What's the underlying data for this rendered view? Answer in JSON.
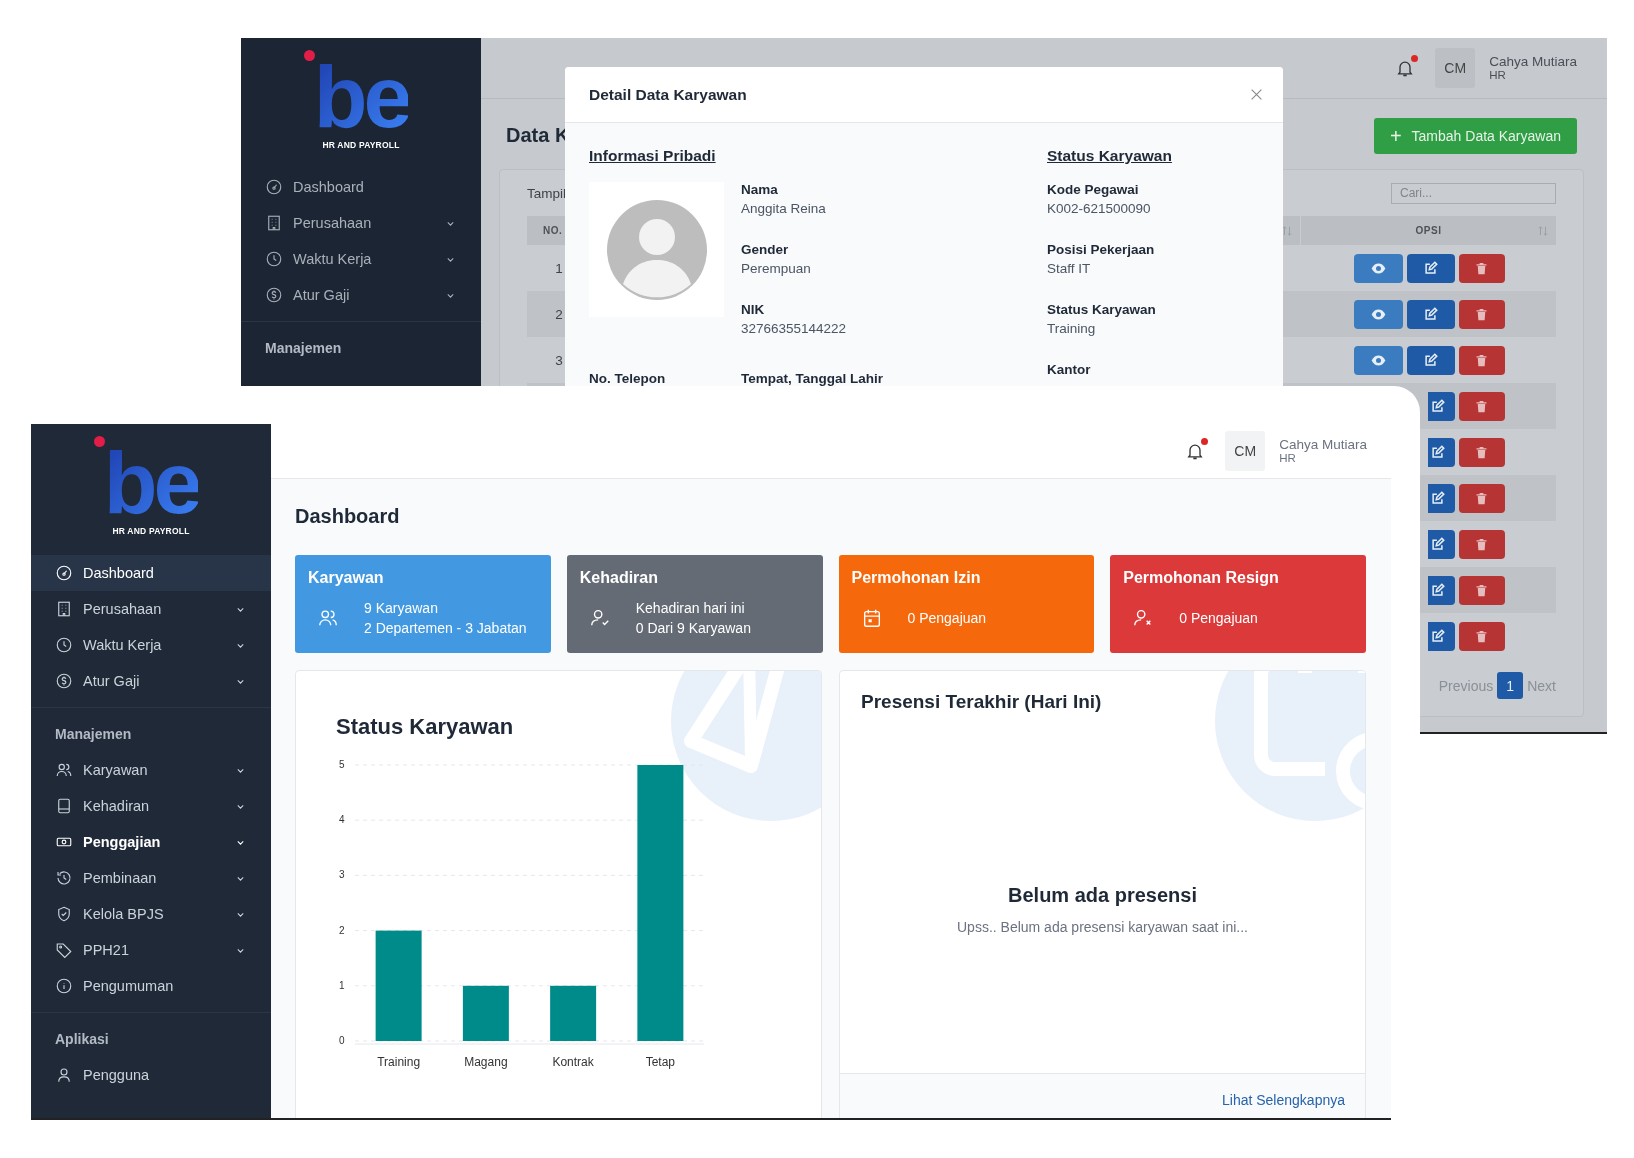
{
  "back_window": {
    "sidebar": {
      "logo": {
        "mark": "be",
        "caption": "HR AND PAYROLL"
      },
      "items": [
        {
          "label": "Dashboard",
          "has_submenu": false
        },
        {
          "label": "Perusahaan",
          "has_submenu": true
        },
        {
          "label": "Waktu Kerja",
          "has_submenu": true
        },
        {
          "label": "Atur Gaji",
          "has_submenu": true
        }
      ],
      "section_title": "Manajemen"
    },
    "header": {
      "has_notification": true,
      "user": {
        "initials": "CM",
        "name": "Cahya Mutiara",
        "role": "HR"
      }
    },
    "page_title": "Data K",
    "add_button": {
      "icon": "+",
      "label": "Tambah Data Karyawan"
    },
    "table_card": {
      "show_label": "Tampil",
      "search": {
        "placeholder": "Cari..."
      },
      "columns": [
        "NO.",
        "OPSI"
      ],
      "rows": [
        {
          "number": "1",
          "actions": [
            {
              "kind": "view"
            },
            {
              "kind": "edit"
            },
            {
              "kind": "delete"
            }
          ]
        },
        {
          "number": "2",
          "actions": [
            {
              "kind": "view"
            },
            {
              "kind": "edit"
            },
            {
              "kind": "delete"
            }
          ]
        },
        {
          "number": "3",
          "actions": [
            {
              "kind": "view"
            },
            {
              "kind": "edit"
            },
            {
              "kind": "delete"
            }
          ]
        },
        {
          "actions": [
            {
              "kind": "edit"
            },
            {
              "kind": "delete"
            }
          ]
        },
        {
          "actions": [
            {
              "kind": "edit"
            },
            {
              "kind": "delete"
            }
          ]
        },
        {
          "actions": [
            {
              "kind": "edit"
            },
            {
              "kind": "delete"
            }
          ]
        },
        {
          "actions": [
            {
              "kind": "edit"
            },
            {
              "kind": "delete"
            }
          ]
        },
        {
          "actions": [
            {
              "kind": "edit"
            },
            {
              "kind": "delete"
            }
          ]
        },
        {
          "actions": [
            {
              "kind": "edit"
            },
            {
              "kind": "delete"
            }
          ]
        }
      ],
      "pagination": {
        "previous": "Previous",
        "pages": [
          {
            "label": "1",
            "selected": true
          }
        ],
        "next": "Next"
      }
    },
    "modal": {
      "title": "Detail Data Karyawan",
      "personal": {
        "heading": "Informasi Pribadi",
        "fields": [
          {
            "label": "Nama",
            "value": "Anggita Reina"
          },
          {
            "label": "Gender",
            "value": "Perempuan"
          },
          {
            "label": "NIK",
            "value": "32766355144222"
          }
        ],
        "bottom_fields": [
          {
            "label": "No. Telepon"
          },
          {
            "label": "Tempat, Tanggal Lahir"
          }
        ]
      },
      "status": {
        "heading": "Status Karyawan",
        "fields": [
          {
            "label": "Kode Pegawai",
            "value": "K002-621500090"
          },
          {
            "label": "Posisi Pekerjaan",
            "value": "Staff IT"
          },
          {
            "label": "Status Karyawan",
            "value": "Training"
          },
          {
            "label": "Kantor"
          }
        ]
      }
    }
  },
  "front_window": {
    "sidebar": {
      "logo": {
        "mark": "be",
        "caption": "HR AND PAYROLL"
      },
      "groups": [
        {
          "items": [
            {
              "label": "Dashboard",
              "has_submenu": false,
              "selected": true,
              "hover": false
            },
            {
              "label": "Perusahaan",
              "has_submenu": true,
              "selected": false,
              "hover": false
            },
            {
              "label": "Waktu Kerja",
              "has_submenu": true,
              "selected": false,
              "hover": false
            },
            {
              "label": "Atur Gaji",
              "has_submenu": true,
              "selected": false,
              "hover": false
            }
          ]
        },
        {
          "title": "Manajemen",
          "items": [
            {
              "label": "Karyawan",
              "has_submenu": true,
              "selected": false,
              "hover": false
            },
            {
              "label": "Kehadiran",
              "has_submenu": true,
              "selected": false,
              "hover": false
            },
            {
              "label": "Penggajian",
              "has_submenu": true,
              "selected": false,
              "hover": true
            },
            {
              "label": "Pembinaan",
              "has_submenu": true,
              "selected": false,
              "hover": false
            },
            {
              "label": "Kelola BPJS",
              "has_submenu": true,
              "selected": false,
              "hover": false
            },
            {
              "label": "PPH21",
              "has_submenu": true,
              "selected": false,
              "hover": false
            },
            {
              "label": "Pengumuman",
              "has_submenu": false,
              "selected": false,
              "hover": false
            }
          ]
        },
        {
          "title": "Aplikasi",
          "items": [
            {
              "label": "Pengguna",
              "has_submenu": false,
              "selected": false,
              "hover": false
            }
          ]
        }
      ]
    },
    "header": {
      "has_notification": true,
      "user": {
        "initials": "CM",
        "name": "Cahya Mutiara",
        "role": "HR"
      }
    },
    "page_title": "Dashboard",
    "cards": [
      {
        "title": "Karyawan",
        "lines": [
          "9 Karyawan",
          "2 Departemen - 3 Jabatan"
        ],
        "color": "#4299e1"
      },
      {
        "title": "Kehadiran",
        "lines": [
          "Kehadiran hari ini",
          "0 Dari 9 Karyawan"
        ],
        "color": "#646b75"
      },
      {
        "title": "Permohonan Izin",
        "lines": [
          "0 Pengajuan"
        ],
        "color": "#f5680c"
      },
      {
        "title": "Permohonan Resign",
        "lines": [
          "0 Pengajuan"
        ],
        "color": "#dc3a3a"
      }
    ],
    "chart_panel": {
      "chart_data": {
        "type": "bar",
        "grid": true,
        "title": "Status Karyawan",
        "categories": [
          "Training",
          "Magang",
          "Kontrak",
          "Tetap"
        ],
        "values": [
          2,
          1,
          1,
          5
        ],
        "ylim": [
          0,
          5
        ],
        "yticks": [
          0,
          1,
          2,
          3,
          4,
          5
        ]
      }
    },
    "attendance_panel": {
      "title": "Presensi Terakhir (Hari Ini)",
      "empty_title": "Belum ada presensi",
      "empty_message": "Upss.. Belum ada presensi karyawan saat ini...",
      "link": "Lihat Selengkapnya"
    }
  }
}
